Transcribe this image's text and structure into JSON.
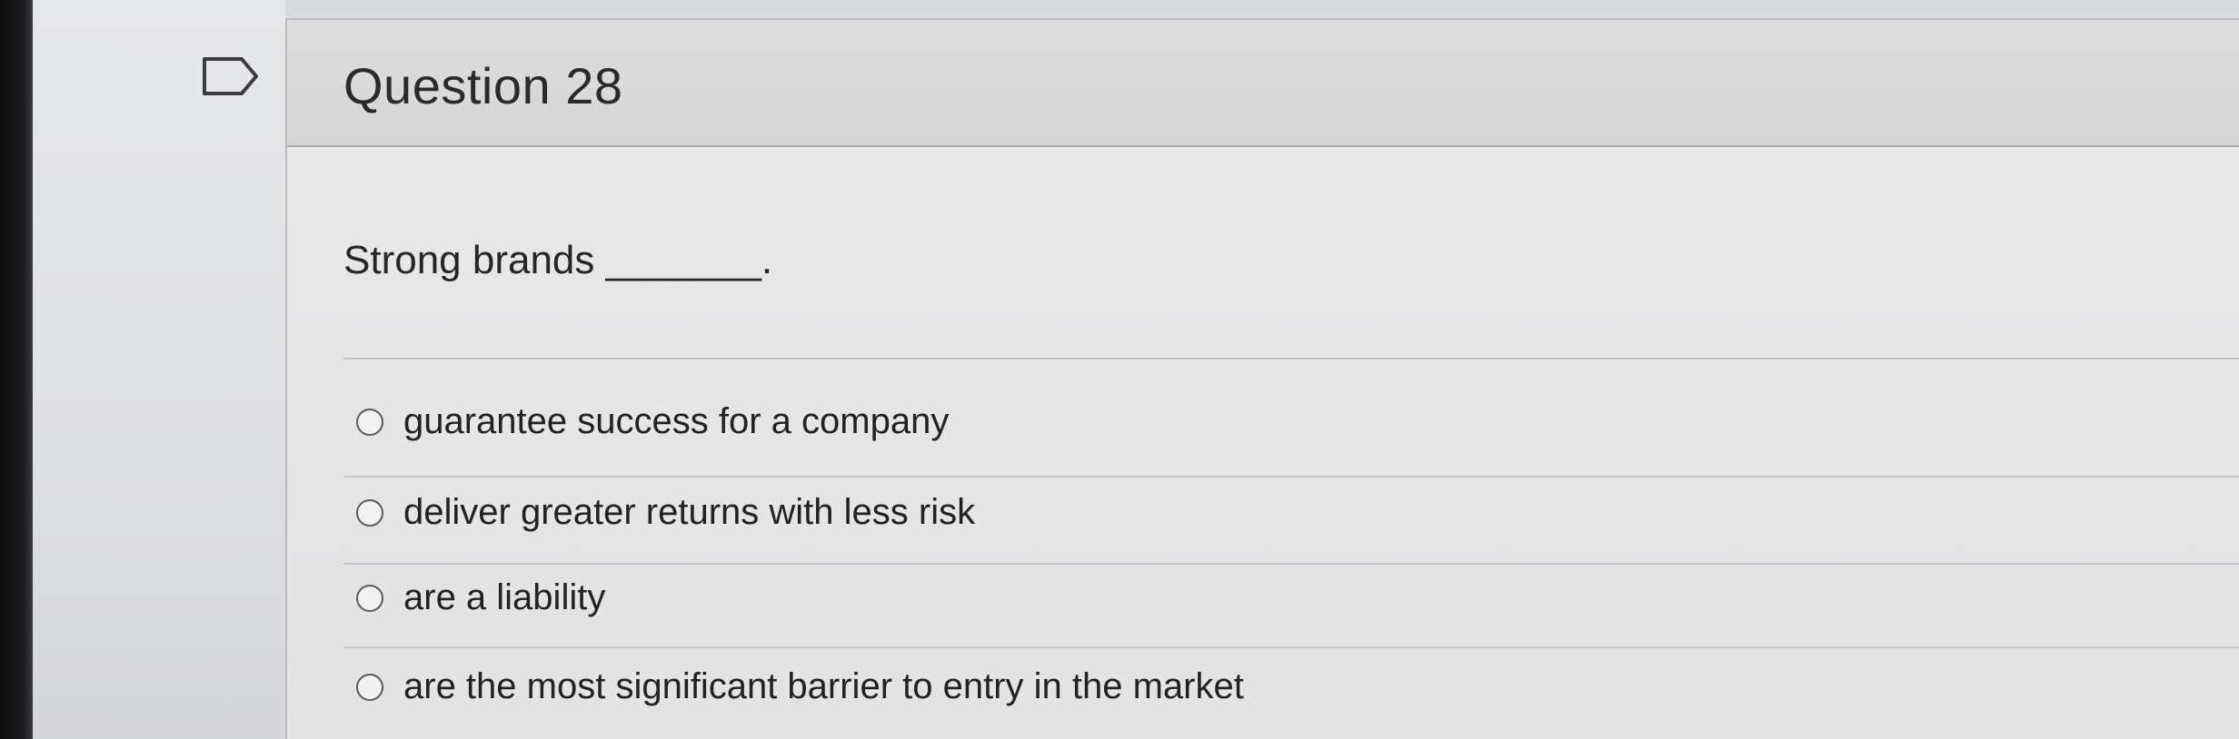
{
  "question": {
    "title": "Question 28",
    "prompt": "Strong brands _______.",
    "options": [
      {
        "label": "guarantee success for a company"
      },
      {
        "label": "deliver greater returns with less risk"
      },
      {
        "label": "are a liability"
      },
      {
        "label": "are the most significant barrier to entry in the market"
      }
    ]
  },
  "icons": {
    "flag": "flag-icon",
    "radio": "radio-button-icon"
  }
}
